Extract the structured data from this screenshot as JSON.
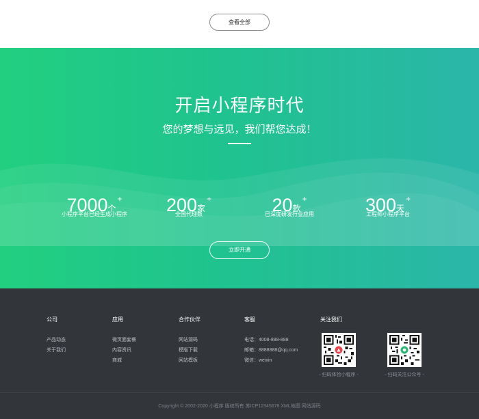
{
  "top": {
    "view_all_label": "查看全部"
  },
  "hero": {
    "title": "开启小程序时代",
    "subtitle": "您的梦想与远见，我们帮您达成！",
    "open_button_label": "立即开通",
    "stats": [
      {
        "number": "7000",
        "unit": "个",
        "plus": "+",
        "desc": "小程序平台已经生成小程序"
      },
      {
        "number": "200",
        "unit": "家",
        "plus": "+",
        "desc": "全国代理数"
      },
      {
        "number": "20",
        "unit": "款",
        "plus": "+",
        "desc": "已深度研发行业应用"
      },
      {
        "number": "300",
        "unit": "天",
        "plus": "+",
        "desc": "工程师小程序平台"
      }
    ]
  },
  "footer": {
    "columns": [
      {
        "title": "公司",
        "links": [
          "产品动态",
          "关于我们"
        ]
      },
      {
        "title": "应用",
        "links": [
          "微页面套餐",
          "内容资讯",
          "商城"
        ]
      },
      {
        "title": "合作伙伴",
        "links": [
          "网站源码",
          "模版下载",
          "网站模板"
        ]
      },
      {
        "title": "客服",
        "info": [
          "电话：4008-888-888",
          "邮箱：8888888@qq.com",
          "微信：weixin"
        ]
      }
    ],
    "follow_title": "关注我们",
    "qr_codes": [
      {
        "caption": "- 扫码体验小程序 -",
        "badge_color": "#e8434b"
      },
      {
        "caption": "- 扫码关注公众号 -",
        "badge_color": "#2bb673"
      }
    ],
    "copyright": "Copyright © 2002-2020 小程序 版权所有 苏ICP12345678 XML地图 网站源码"
  },
  "colors": {
    "hero_gradient_start": "#22cf80",
    "hero_gradient_end": "#2bb6a9",
    "footer_bg": "#32363b"
  }
}
